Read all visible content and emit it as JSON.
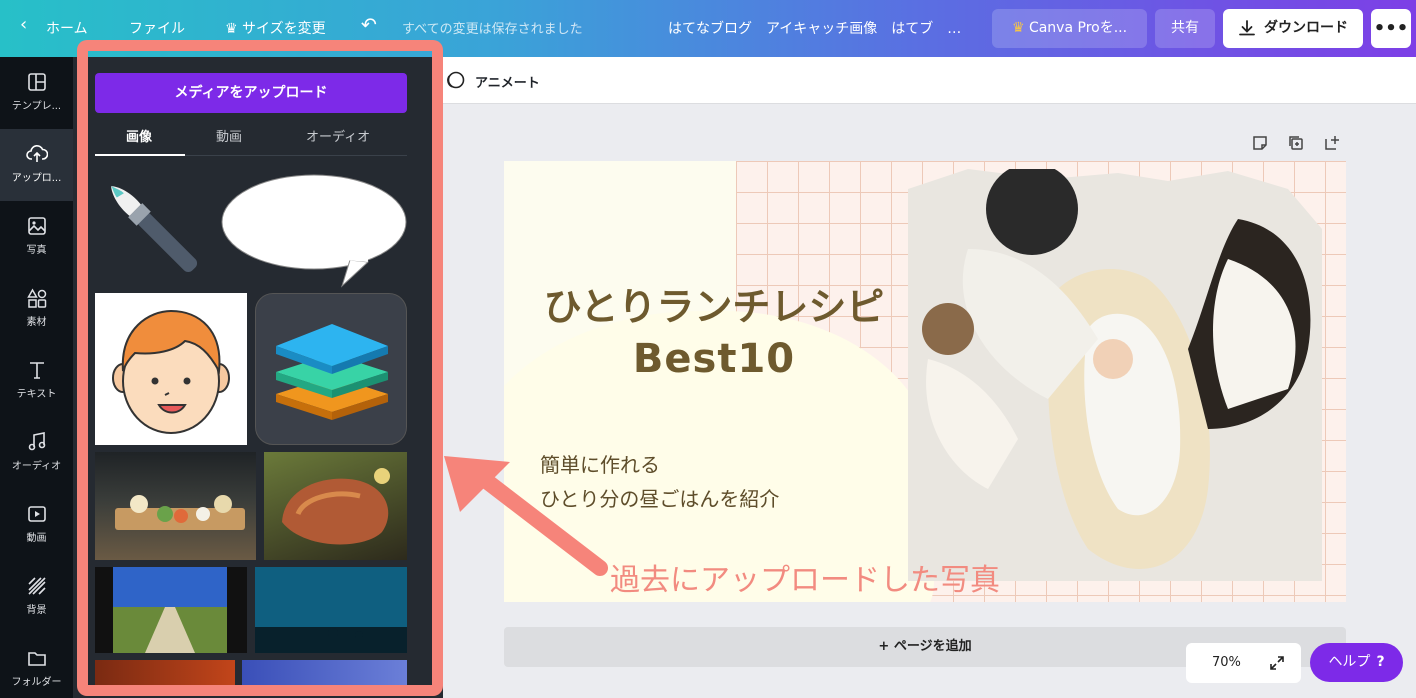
{
  "topbar": {
    "home": "ホーム",
    "file": "ファイル",
    "resize": "サイズを変更",
    "saved": "すべての変更は保存されました",
    "title": "はてなブログ　アイキャッチ画像　はてブ　…",
    "pro": "Canva Proを...",
    "share": "共有",
    "download": "ダウンロード",
    "more": "•••"
  },
  "rail": {
    "items": [
      {
        "label": "テンプレ...",
        "icon": "template-icon"
      },
      {
        "label": "アップロ...",
        "icon": "upload-icon"
      },
      {
        "label": "写真",
        "icon": "photo-icon"
      },
      {
        "label": "素材",
        "icon": "elements-icon"
      },
      {
        "label": "テキスト",
        "icon": "text-icon"
      },
      {
        "label": "オーディオ",
        "icon": "audio-icon"
      },
      {
        "label": "動画",
        "icon": "video-icon"
      },
      {
        "label": "背景",
        "icon": "background-icon"
      },
      {
        "label": "フォルダー",
        "icon": "folder-icon"
      }
    ]
  },
  "panel": {
    "upload_button": "メディアをアップロード",
    "tabs": [
      "画像",
      "動画",
      "オーディオ"
    ]
  },
  "toolbar": {
    "animate": "アニメート"
  },
  "design": {
    "title_line1": "ひとりランチレシピ",
    "title_line2": "Best10",
    "sub_line1": "簡単に作れる",
    "sub_line2": "ひとり分の昼ごはんを紹介"
  },
  "canvas": {
    "add_page": "+ ページを追加",
    "zoom": "70%",
    "help": "ヘルプ",
    "help_mark": "?"
  },
  "annotation": {
    "text": "過去にアップロードした写真"
  },
  "colors": {
    "accent": "#7d2ae8",
    "annotation": "#f6847a"
  }
}
